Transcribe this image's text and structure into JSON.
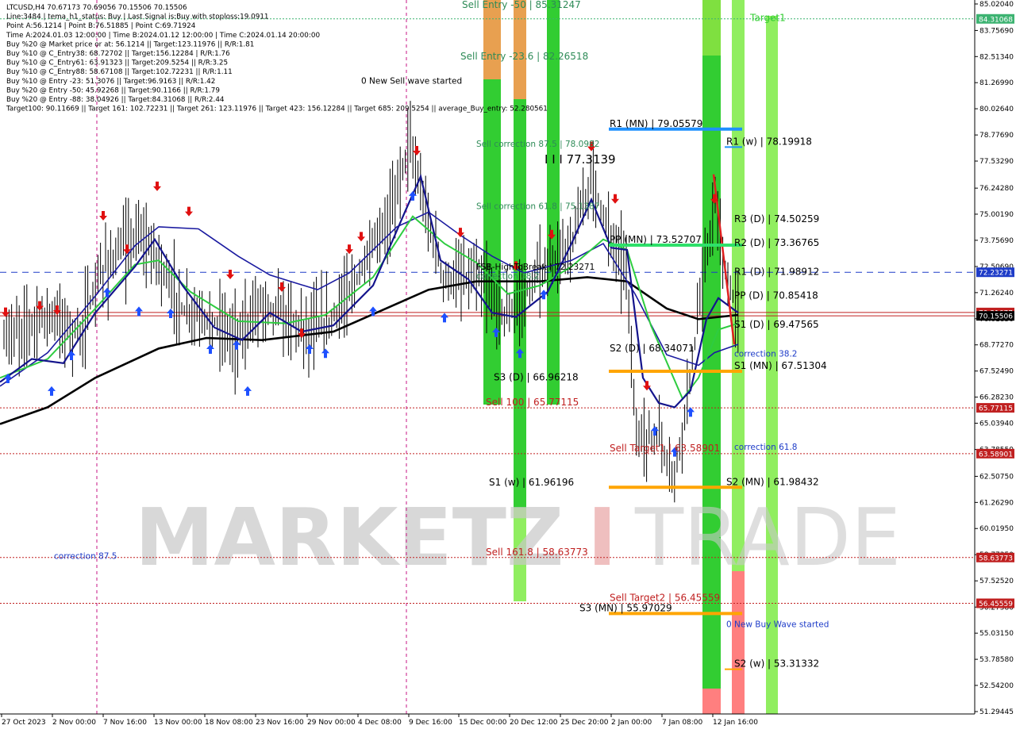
{
  "header": {
    "lines": [
      "LTCUSD,H4  70.67173 70.69056 70.15506 70.15506",
      "Line:3484 | tema_h1_status: Buy | Last Signal is:Buy with stoploss:19.0911",
      "Point A:56.1214 | Point B:76.51885 | Point C:69.71924",
      "Time A:2024.01.03 12:00:00 | Time B:2024.01.12 12:00:00 | Time C:2024.01.14 20:00:00",
      "Buy %20 @ Market price or at: 56.1214 || Target:123.11976 || R/R:1.81",
      "Buy %10 @ C_Entry38: 68.72702 || Target:156.12284 | R/R:1.76",
      "Buy %10 @ C_Entry61: 63.91323 || Target:209.5254 || R/R:3.25",
      "Buy %10 @ C_Entry88: 58.67108 || Target:102.72231 || R/R:1.11",
      "Buy %10 @ Entry -23: 51.3076 || Target:96.9163 || R/R:1.42",
      "Buy %20 @ Entry -50: 45.92268 || Target:90.1166 || R/R:1.79",
      "Buy %20 @ Entry -88: 38.04926 || Target:84.31068 || R/R:2.44",
      "Target100: 90.11669 || Target 161: 102.72231 || Target 261: 123.11976 || Target 423: 156.12284 || Target 685: 209.5254 || average_Buy_entry: 52.280561"
    ]
  },
  "watermark": {
    "part1": "MARKETZ",
    "part2": "I",
    "part3": "TRADE"
  },
  "chart_data": {
    "type": "candlestick",
    "symbol": "LTCUSD",
    "timeframe": "H4",
    "last_price": "70.15506",
    "ylim": [
      51.29445,
      85.0204
    ],
    "price_ticks": [
      "85.02040",
      "83.75690",
      "82.51340",
      "81.26990",
      "80.02640",
      "78.77690",
      "77.53290",
      "76.24280",
      "75.00190",
      "73.75690",
      "72.50690",
      "71.26240",
      "70.01850",
      "68.77270",
      "67.52490",
      "66.28230",
      "65.03940",
      "63.78550",
      "62.50750",
      "61.26290",
      "60.01950",
      "58.77350",
      "57.52520",
      "56.27580",
      "55.03150",
      "53.78580",
      "52.54200",
      "51.29445"
    ],
    "x_labels": [
      "27 Oct 2023",
      "2 Nov 00:00",
      "7 Nov 16:00",
      "13 Nov 00:00",
      "18 Nov 08:00",
      "23 Nov 16:00",
      "29 Nov 00:00",
      "4 Dec 08:00",
      "9 Dec 16:00",
      "15 Dec 00:00",
      "20 Dec 12:00",
      "25 Dec 20:00",
      "2 Jan 00:00",
      "7 Jan 08:00",
      "12 Jan 16:00"
    ],
    "price_tags": [
      {
        "value": 84.31068,
        "label": "84.31068",
        "color": "#3cb371"
      },
      {
        "value": 72.23271,
        "label": "72.23271",
        "color": "#1e3cc8"
      },
      {
        "value": 70.31677,
        "label": "70.31677",
        "color": "#c02020"
      },
      {
        "value": 70.15506,
        "label": "70.15506",
        "color": "#000000"
      },
      {
        "value": 65.77115,
        "label": "65.77115",
        "color": "#c02020"
      },
      {
        "value": 63.58901,
        "label": "63.58901",
        "color": "#c02020"
      },
      {
        "value": 58.63773,
        "label": "58.63773",
        "color": "#c02020"
      },
      {
        "value": 56.45559,
        "label": "56.45559",
        "color": "#c02020"
      }
    ],
    "annotations": [
      {
        "text": "Sell Entry -50 | 85.31247",
        "value": 85.31247,
        "color": "#2e8b57"
      },
      {
        "text": "Sell Entry -23.6 | 82.26518",
        "value": 82.26518,
        "color": "#2e8b57"
      },
      {
        "text": "0 New Sell wave started",
        "value": 81.1,
        "color": "#000000"
      },
      {
        "text": "Target1",
        "value": 84.1,
        "color": "#32cd32"
      },
      {
        "text": "R1 (MN) | 79.05579",
        "value": 79.05579,
        "color": "#000000"
      },
      {
        "text": "I I I 77.3139",
        "value": 77.3139,
        "color": "#000000"
      },
      {
        "text": "R1 (w) | 78.19918",
        "value": 78.19918,
        "color": "#000000"
      },
      {
        "text": "Sell correction 87.5 | 78.0982",
        "value": 78.0982,
        "color": "#2e8b57"
      },
      {
        "text": "Sell correction 61.8 | 75.1387",
        "value": 75.1387,
        "color": "#2e8b57"
      },
      {
        "text": "R3 (D) | 74.50259",
        "value": 74.50259,
        "color": "#000000"
      },
      {
        "text": "PP (MN) | 73.52707",
        "value": 73.52707,
        "color": "#000000"
      },
      {
        "text": "R2 (D) | 73.36765",
        "value": 73.36765,
        "color": "#000000"
      },
      {
        "text": "R1 (D) | 71.98912",
        "value": 71.98912,
        "color": "#000000"
      },
      {
        "text": "PP (D) | 70.85418",
        "value": 70.85418,
        "color": "#000000"
      },
      {
        "text": "S1 (D) | 69.47565",
        "value": 69.47565,
        "color": "#000000"
      },
      {
        "text": "S2 (D) | 68.34071",
        "value": 68.34071,
        "color": "#000000"
      },
      {
        "text": "S1 (MN) | 67.51304",
        "value": 67.51304,
        "color": "#000000"
      },
      {
        "text": "S3 (D) | 66.96218",
        "value": 66.96218,
        "color": "#000000"
      },
      {
        "text": "Sell 100 | 65.77115",
        "value": 65.77115,
        "color": "#c02020"
      },
      {
        "text": "Sell Target1 | 63.58901",
        "value": 63.58901,
        "color": "#c02020"
      },
      {
        "text": "S2 (MN) | 61.98432",
        "value": 61.98432,
        "color": "#000000"
      },
      {
        "text": "S1 (w) | 61.96196",
        "value": 61.96196,
        "color": "#000000"
      },
      {
        "text": "Sell 161.8 | 58.63773",
        "value": 58.63773,
        "color": "#c02020"
      },
      {
        "text": "Sell Target2 | 56.45559",
        "value": 56.45559,
        "color": "#c02020"
      },
      {
        "text": "S3 (MN) | 55.97029",
        "value": 55.97029,
        "color": "#000000"
      },
      {
        "text": "0 New Buy Wave started",
        "value": 55.2,
        "color": "#1e3cc8"
      },
      {
        "text": "S2 (w) | 53.31332",
        "value": 53.31332,
        "color": "#000000"
      },
      {
        "text": "correction 38.2",
        "value": 68.1,
        "color": "#1e3cc8"
      },
      {
        "text": "correction 61.8",
        "value": 63.65,
        "color": "#1e3cc8"
      },
      {
        "text": "correction 87.5",
        "value": 58.46,
        "color": "#1e3cc8"
      },
      {
        "text": "FSB-HighToBreak | 72.23271",
        "value": 72.23271,
        "color": "#000000"
      },
      {
        "text": "correction 38.2",
        "value": 71.8,
        "color": "#2e8b57"
      }
    ]
  }
}
